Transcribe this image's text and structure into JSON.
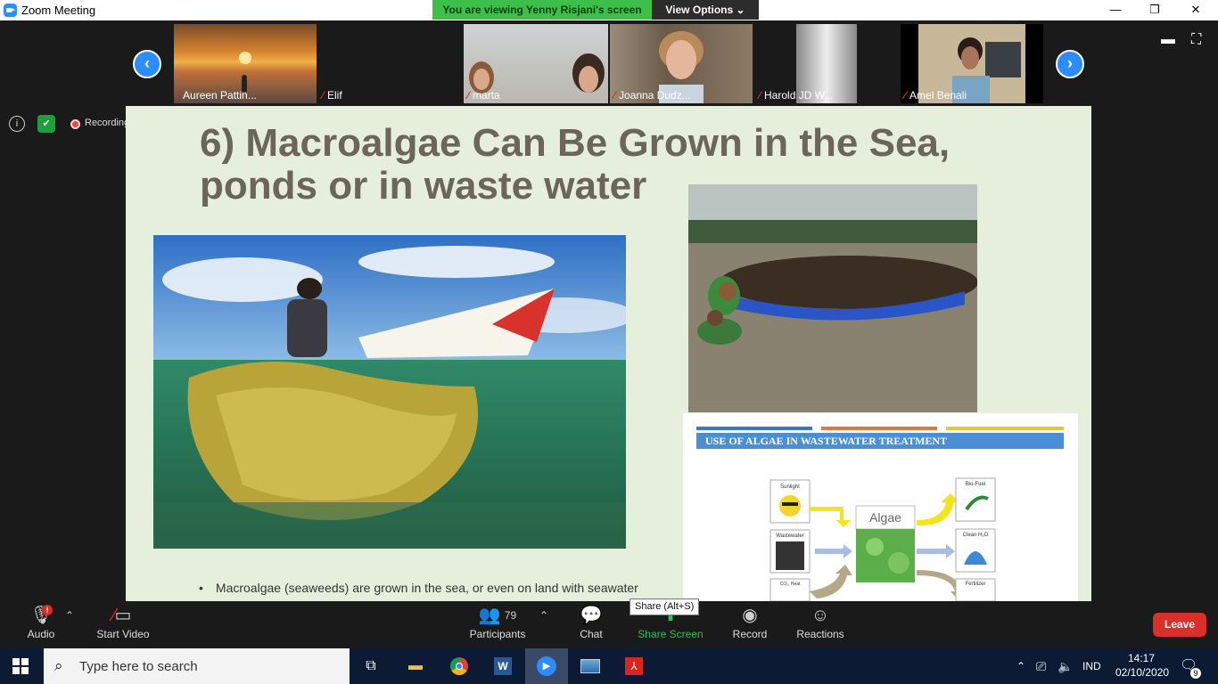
{
  "app": {
    "title": "Zoom Meeting"
  },
  "share_banner": {
    "viewing": "You are viewing Yenny Risjani's screen",
    "view_options": "View Options"
  },
  "participants": [
    {
      "name": "Aureen Pattin..."
    },
    {
      "name": "Elif"
    },
    {
      "name": "marta"
    },
    {
      "name": "Joanna Dudz..."
    },
    {
      "name": "Harold JD W..."
    },
    {
      "name": "Amel Benali"
    }
  ],
  "status": {
    "recording": "Recording"
  },
  "slide": {
    "title_line1": "6) Macroalgae Can Be Grown in the Sea,",
    "title_line2": "ponds or in waste water",
    "bullet": "Macroalgae (seaweeds) are grown in the sea, or even on land with seawater",
    "diagram": {
      "header": "USE OF ALGAE IN WASTEWATER TREATMENT",
      "center": "Algae",
      "sunlight": "Sunlight",
      "wastewater": "Wastewater",
      "co2": "CO₂, Heat",
      "biofuel": "Bio-Fuel",
      "cleanwater": "Clean H₂O",
      "fertilizer": "Fertilizer"
    }
  },
  "toolbar": {
    "audio": "Audio",
    "start_video": "Start Video",
    "participants_count": "79",
    "participants": "Participants",
    "chat": "Chat",
    "share_screen": "Share Screen",
    "share_tooltip": "Share (Alt+S)",
    "record": "Record",
    "reactions": "Reactions",
    "leave": "Leave"
  },
  "taskbar": {
    "search_placeholder": "Type here to search",
    "language": "IND",
    "time": "14:17",
    "date": "02/10/2020",
    "notifications": "9"
  },
  "colors": {
    "zoom_blue": "#2d8cff",
    "banner_green": "#3cc04a",
    "leave_red": "#d9302c",
    "slide_bg": "#e6efdc",
    "title_text": "#6b6657"
  }
}
